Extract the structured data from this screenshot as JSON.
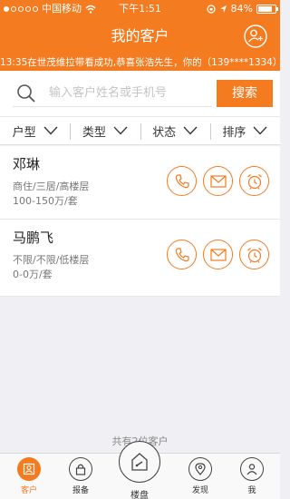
{
  "colors": {
    "accent": "#f47b20",
    "background": "#efeff4"
  },
  "status_bar": {
    "carrier": "中国移动",
    "time": "下午1:51",
    "battery": "84%",
    "battery_level": 0.84
  },
  "header": {
    "title": "我的客户",
    "add_icon": "add-person-icon",
    "ticker": "13:35在世茂维拉带看成功,恭喜张浩先生，你的（139****1334）客户"
  },
  "search": {
    "placeholder": "输入客户姓名或手机号",
    "button": "搜索"
  },
  "filters": [
    {
      "label": "户型"
    },
    {
      "label": "类型"
    },
    {
      "label": "状态"
    },
    {
      "label": "排序"
    }
  ],
  "customers": [
    {
      "name": "邓琳",
      "detail": "商住/三居/高楼层",
      "price": "100-150万/套"
    },
    {
      "name": "马鹏飞",
      "detail": "不限/不限/低楼层",
      "price": "0-0万/套"
    }
  ],
  "total_text": "共有2位客户",
  "tabbar": {
    "customer": "客户",
    "report": "报备",
    "property": "楼盘",
    "discover": "发现",
    "me": "我"
  }
}
